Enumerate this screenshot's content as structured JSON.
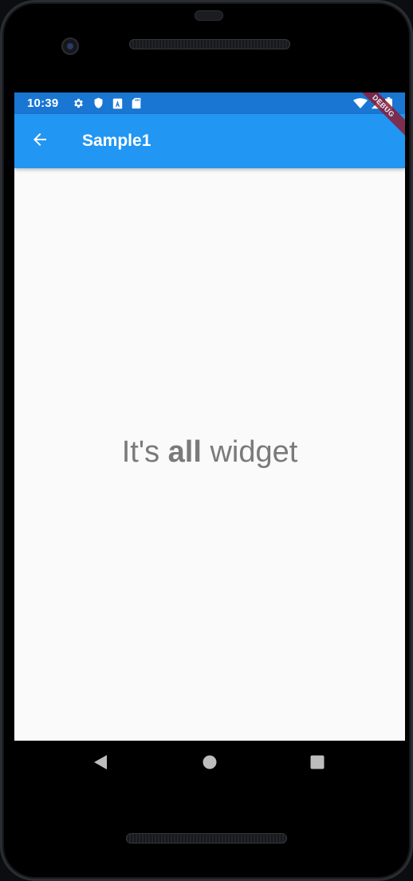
{
  "status_bar": {
    "time": "10:39",
    "left_icons": [
      "settings-icon",
      "shield-icon",
      "a-icon",
      "sd-card-icon"
    ],
    "right_icons": [
      "wifi-icon",
      "signal-icon",
      "battery-icon"
    ]
  },
  "app_bar": {
    "title": "Sample1",
    "back_icon": "arrow-back-icon"
  },
  "debug_banner": {
    "label": "DEBUG"
  },
  "body": {
    "text_before": "It's ",
    "text_bold": "all",
    "text_after": " widget"
  },
  "nav_bar": {
    "buttons": [
      "back-triangle-icon",
      "home-circle-icon",
      "recents-square-icon"
    ]
  },
  "colors": {
    "status_bar": "#1976d2",
    "app_bar": "#2196f3",
    "background": "#fafafa",
    "body_text": "#7a7a7a",
    "debug_banner": "#8b1c34"
  }
}
